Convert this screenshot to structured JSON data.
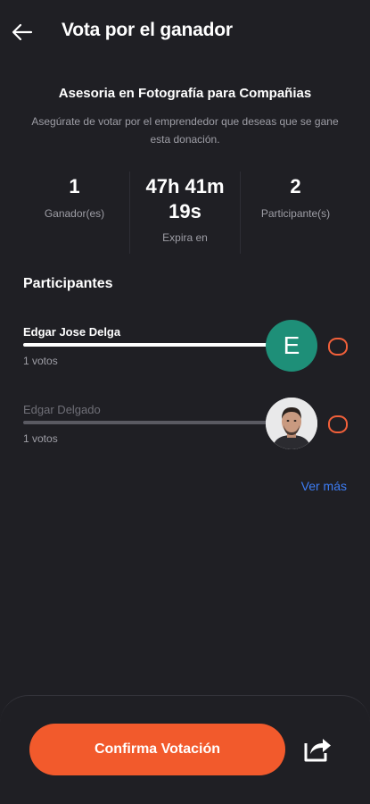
{
  "header": {
    "back_icon": "arrow-left-icon",
    "title": "Vota por el ganador"
  },
  "info": {
    "subtitle": "Asesoria en Fotografía para Compañias",
    "description": "Asegúrate de votar por el emprendedor que deseas que se gane esta donación."
  },
  "stats": {
    "winners_value": "1",
    "winners_label": "Ganador(es)",
    "time_line1": "47h 41m",
    "time_line2": "19s",
    "time_label": "Expira en",
    "participants_value": "2",
    "participants_label": "Participante(s)"
  },
  "participants_section": {
    "title": "Participantes",
    "items": [
      {
        "name": "Edgar Jose Delga",
        "votes": "1 votos",
        "avatar_initial": "E",
        "avatar_color": "#1e8f78",
        "selected": false
      },
      {
        "name": "Edgar Delgado",
        "votes": "1 votos",
        "avatar_initial": "",
        "avatar_color": "#e9e9ea",
        "selected": false
      }
    ],
    "see_more": "Ver más"
  },
  "footer": {
    "confirm_label": "Confirma Votación",
    "share_icon": "share-icon"
  },
  "colors": {
    "background": "#1f1f24",
    "accent": "#f25a2c",
    "link": "#3d7df5",
    "muted_text": "#9e9ea6"
  }
}
